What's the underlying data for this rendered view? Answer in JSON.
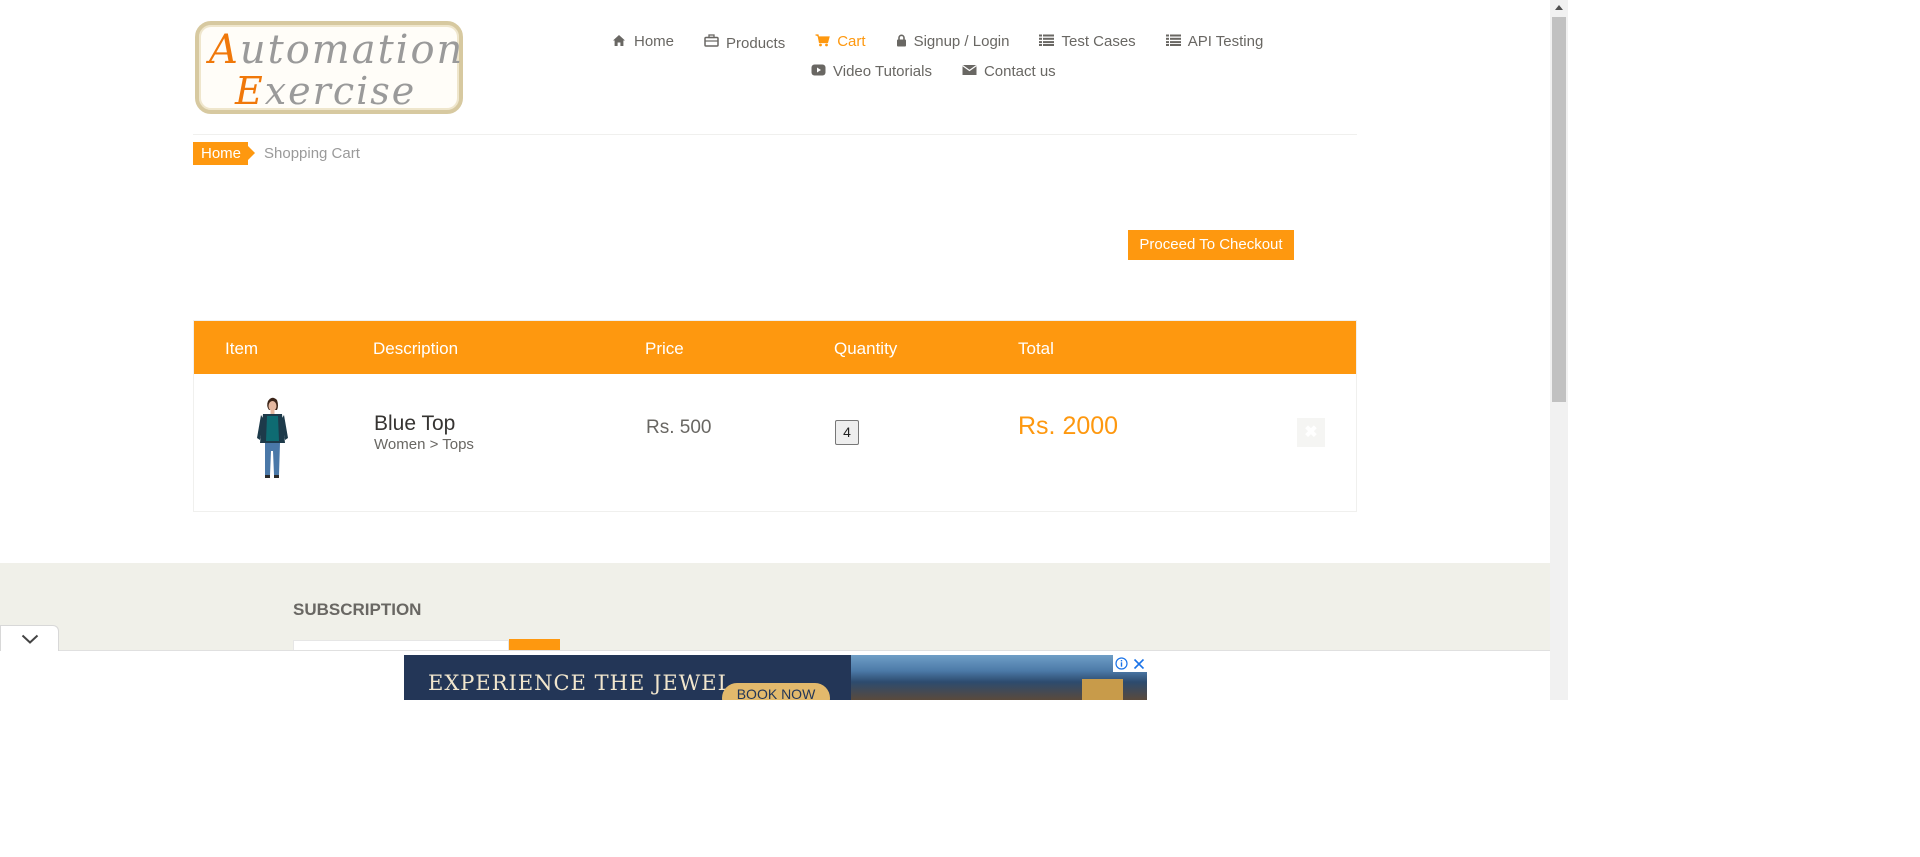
{
  "logo": {
    "line1_cap": "A",
    "line1_rest": "utomation",
    "line2_cap": "E",
    "line2_rest": "xercise"
  },
  "nav": {
    "home": "Home",
    "products": "Products",
    "cart": "Cart",
    "signup_login": "Signup / Login",
    "test_cases": "Test Cases",
    "api_testing": "API Testing",
    "video_tutorials": "Video Tutorials",
    "contact_us": "Contact us"
  },
  "breadcrumb": {
    "home": "Home",
    "current": "Shopping Cart"
  },
  "checkout_button": "Proceed To Checkout",
  "cart_table": {
    "headers": {
      "item": "Item",
      "description": "Description",
      "price": "Price",
      "quantity": "Quantity",
      "total": "Total"
    },
    "rows": [
      {
        "name": "Blue Top",
        "category": "Women > Tops",
        "price": "Rs. 500",
        "quantity": "4",
        "total": "Rs. 2000",
        "delete_icon": "close-icon"
      }
    ]
  },
  "footer": {
    "subscription_title": "SUBSCRIPTION"
  },
  "ad": {
    "headline": "EXPERIENCE THE JEWEL",
    "cta": "BOOK NOW"
  },
  "colors": {
    "accent": "#fe980f",
    "text": "#696763",
    "footer_bg": "#f0f0e9"
  }
}
